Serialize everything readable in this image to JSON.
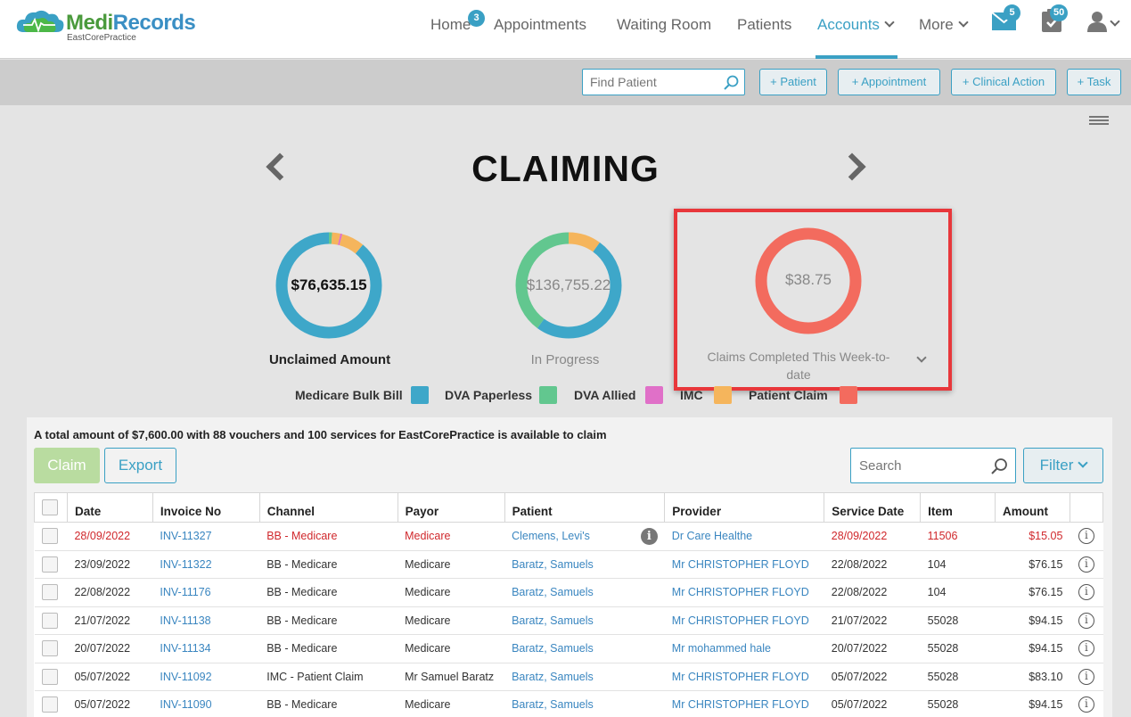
{
  "brand": {
    "name_part1": "Medi",
    "name_part2": "Records",
    "subtitle": "EastCorePractice"
  },
  "nav": {
    "home": "Home",
    "home_badge": "3",
    "appointments": "Appointments",
    "waiting_room": "Waiting Room",
    "patients": "Patients",
    "accounts": "Accounts",
    "more": "More",
    "mail_badge": "5",
    "tasks_badge": "50"
  },
  "toolbar": {
    "find_placeholder": "Find Patient",
    "add_patient": "+ Patient",
    "add_appointment": "+ Appointment",
    "add_clinical_action": "+ Clinical Action",
    "add_task": "+ Task"
  },
  "page_title": "CLAIMING",
  "donuts": {
    "unclaimed": {
      "value": "$76,635.15",
      "label": "Unclaimed Amount"
    },
    "in_progress": {
      "value": "$136,755.22",
      "label": "In Progress"
    },
    "completed": {
      "value": "$38.75",
      "label": "Claims Completed This Week-to-date"
    }
  },
  "legend": [
    {
      "label": "Medicare Bulk Bill",
      "color": "#3ea7c9"
    },
    {
      "label": "DVA Paperless",
      "color": "#62c78f"
    },
    {
      "label": "DVA Allied",
      "color": "#e070c8"
    },
    {
      "label": "IMC",
      "color": "#f5b55c"
    },
    {
      "label": "Patient Claim",
      "color": "#f36b5e"
    }
  ],
  "summary": "A total amount of $7,600.00 with 88 vouchers and 100 services for EastCorePractice is available to claim",
  "actions": {
    "claim": "Claim",
    "export": "Export",
    "search_placeholder": "Search",
    "filter": "Filter"
  },
  "table": {
    "headers": [
      "Date",
      "Invoice No",
      "Channel",
      "Payor",
      "Patient",
      "Provider",
      "Service Date",
      "Item",
      "Amount"
    ],
    "rows": [
      {
        "date": "28/09/2022",
        "invoice": "INV-11327",
        "channel": "BB - Medicare",
        "payor": "Medicare",
        "patient": "Clemens, Levi's",
        "provider": "Dr Care Healthe",
        "service_date": "28/09/2022",
        "item": "11506",
        "amount": "$15.05"
      },
      {
        "date": "23/09/2022",
        "invoice": "INV-11322",
        "channel": "BB - Medicare",
        "payor": "Medicare",
        "patient": "Baratz, Samuels",
        "provider": "Mr CHRISTOPHER FLOYD",
        "service_date": "22/08/2022",
        "item": "104",
        "amount": "$76.15"
      },
      {
        "date": "22/08/2022",
        "invoice": "INV-11176",
        "channel": "BB - Medicare",
        "payor": "Medicare",
        "patient": "Baratz, Samuels",
        "provider": "Mr CHRISTOPHER FLOYD",
        "service_date": "22/08/2022",
        "item": "104",
        "amount": "$76.15"
      },
      {
        "date": "21/07/2022",
        "invoice": "INV-11138",
        "channel": "BB - Medicare",
        "payor": "Medicare",
        "patient": "Baratz, Samuels",
        "provider": "Mr CHRISTOPHER FLOYD",
        "service_date": "21/07/2022",
        "item": "55028",
        "amount": "$94.15"
      },
      {
        "date": "20/07/2022",
        "invoice": "INV-11134",
        "channel": "BB - Medicare",
        "payor": "Medicare",
        "patient": "Baratz, Samuels",
        "provider": "Mr mohammed hale",
        "service_date": "20/07/2022",
        "item": "55028",
        "amount": "$94.15"
      },
      {
        "date": "05/07/2022",
        "invoice": "INV-11092",
        "channel": "IMC - Patient Claim",
        "payor": "Mr Samuel Baratz",
        "patient": "Baratz, Samuels",
        "provider": "Mr CHRISTOPHER FLOYD",
        "service_date": "05/07/2022",
        "item": "55028",
        "amount": "$83.10"
      },
      {
        "date": "05/07/2022",
        "invoice": "INV-11090",
        "channel": "BB - Medicare",
        "payor": "Medicare",
        "patient": "Baratz, Samuels",
        "provider": "Mr CHRISTOPHER FLOYD",
        "service_date": "05/07/2022",
        "item": "55028",
        "amount": "$94.15"
      }
    ]
  }
}
